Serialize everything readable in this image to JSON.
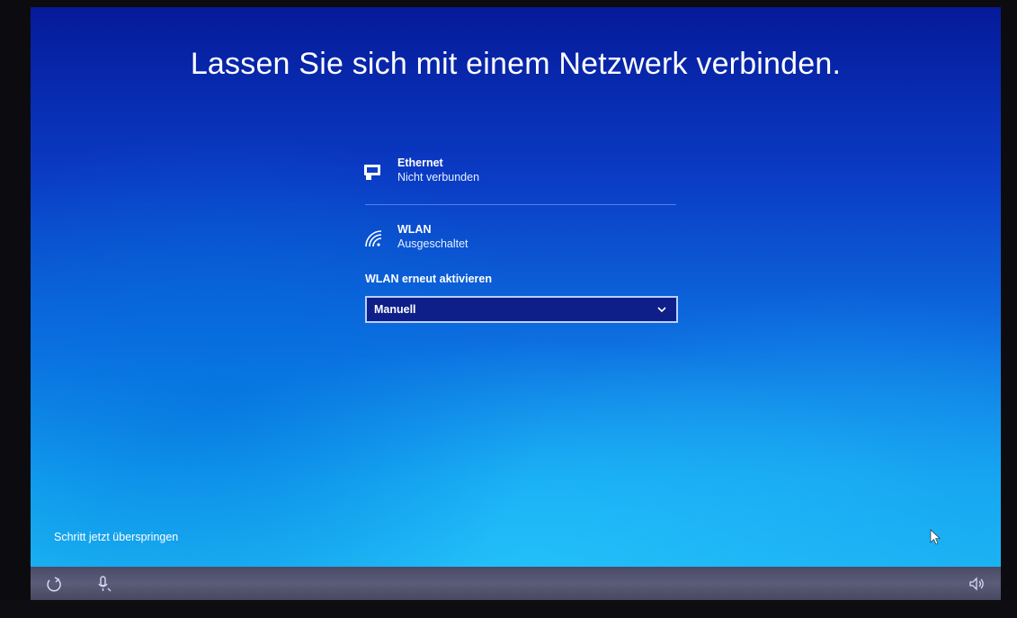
{
  "page": {
    "title": "Lassen Sie sich mit einem Netzwerk verbinden."
  },
  "networks": [
    {
      "name": "Ethernet",
      "status": "Nicht verbunden",
      "icon": "ethernet-icon"
    },
    {
      "name": "WLAN",
      "status": "Ausgeschaltet",
      "icon": "wifi-icon"
    }
  ],
  "wlan_reenable": {
    "label": "WLAN erneut aktivieren",
    "selected": "Manuell"
  },
  "skip_link": "Schritt jetzt überspringen",
  "taskbar": {
    "left_icons": [
      "ease-of-access-icon",
      "microphone-icon"
    ],
    "right_icons": [
      "volume-icon"
    ]
  },
  "colors": {
    "accent_border": "#b9d0ff",
    "dropdown_bg": "#0e1f8a",
    "background_top": "#061a9a",
    "background_bottom": "#1bb4f2"
  }
}
